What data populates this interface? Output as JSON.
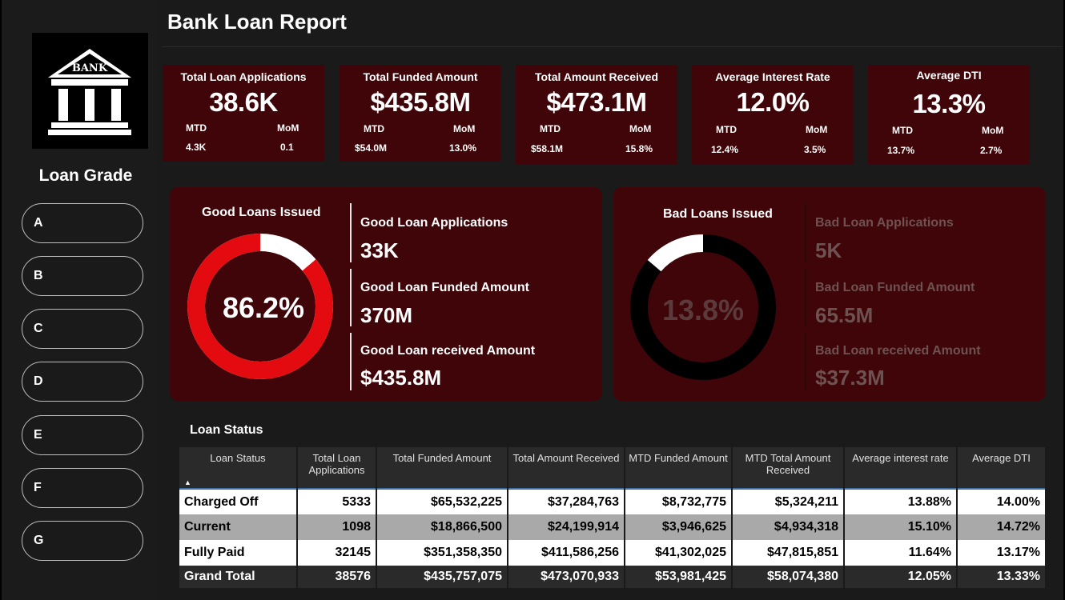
{
  "title": "Bank Loan Report",
  "logo": {
    "text": "BANK"
  },
  "sidebar": {
    "title": "Loan Grade",
    "grades": [
      "A",
      "B",
      "C",
      "D",
      "E",
      "F",
      "G"
    ]
  },
  "kpis": [
    {
      "title": "Total Loan Applications",
      "value": "38.6K",
      "mtd_label": "MTD",
      "mom_label": "MoM",
      "mtd": "4.3K",
      "mom": "0.1"
    },
    {
      "title": "Total Funded Amount",
      "value": "$435.8M",
      "mtd_label": "MTD",
      "mom_label": "MoM",
      "mtd": "$54.0M",
      "mom": "13.0%"
    },
    {
      "title": "Total Amount Received",
      "value": "$473.1M",
      "mtd_label": "MTD",
      "mom_label": "MoM",
      "mtd": "$58.1M",
      "mom": "15.8%"
    },
    {
      "title": "Average Interest Rate",
      "value": "12.0%",
      "mtd_label": "MTD",
      "mom_label": "MoM",
      "mtd": "12.4%",
      "mom": "3.5%"
    },
    {
      "title": "Average DTI",
      "value": "13.3%",
      "mtd_label": "MTD",
      "mom_label": "MoM",
      "mtd": "13.7%",
      "mom": "2.7%"
    }
  ],
  "good": {
    "title": "Good Loans Issued",
    "percent_label": "86.2%",
    "fraction": 0.862,
    "metrics": [
      {
        "label": "Good Loan Applications",
        "value": "33K"
      },
      {
        "label": "Good Loan Funded Amount",
        "value": "370M"
      },
      {
        "label": "Good Loan received Amount",
        "value": "$435.8M"
      }
    ],
    "colors": {
      "filled": "#e30b10",
      "rest": "#ffffff"
    }
  },
  "bad": {
    "title": "Bad Loans Issued",
    "percent_label": "13.8%",
    "fraction": 0.138,
    "metrics": [
      {
        "label": "Bad Loan Applications",
        "value": "5K"
      },
      {
        "label": "Bad Loan Funded Amount",
        "value": "65.5M"
      },
      {
        "label": "Bad Loan received Amount",
        "value": "$37.3M"
      }
    ],
    "colors": {
      "filled": "#ffffff",
      "rest": "#000000"
    }
  },
  "loan_status": {
    "title": "Loan Status",
    "headers": [
      "Loan Status",
      "Total Loan Applications",
      "Total Funded Amount",
      "Total Amount Received",
      "MTD Funded Amount",
      "MTD Total Amount Received",
      "Average interest rate",
      "Average DTI"
    ],
    "rows": [
      [
        "Charged Off",
        "5333",
        "$65,532,225",
        "$37,284,763",
        "$8,732,775",
        "$5,324,211",
        "13.88%",
        "14.00%"
      ],
      [
        "Current",
        "1098",
        "$18,866,500",
        "$24,199,914",
        "$3,946,625",
        "$4,934,318",
        "15.10%",
        "14.72%"
      ],
      [
        "Fully Paid",
        "32145",
        "$351,358,350",
        "$411,586,256",
        "$41,302,025",
        "$47,815,851",
        "11.64%",
        "13.17%"
      ]
    ],
    "total": [
      "Grand Total",
      "38576",
      "$435,757,075",
      "$473,070,933",
      "$53,981,425",
      "$58,074,380",
      "12.05%",
      "13.33%"
    ]
  },
  "colors": {
    "panel": "#3f0508",
    "accent_red": "#e30b10",
    "background": "#1a1a1a"
  }
}
